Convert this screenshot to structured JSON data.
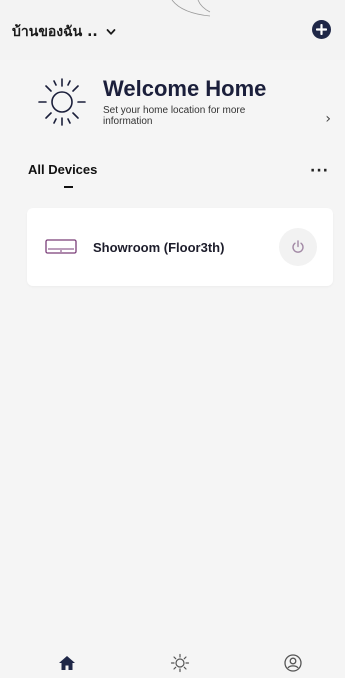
{
  "header": {
    "home_name": "บ้านของฉัน ..",
    "home_dropdown_icon": "chevron-down-icon",
    "add_icon": "plus-circle-icon"
  },
  "welcome": {
    "icon": "sun-icon",
    "title": "Welcome Home",
    "subtitle": "Set your home location for more information",
    "arrow": "›"
  },
  "devices": {
    "section_title": "All Devices",
    "more_label": "···",
    "items": [
      {
        "name": "Showroom (Floor3th)",
        "icon": "air-conditioner-icon",
        "power_icon": "power-icon"
      }
    ]
  },
  "bottom_nav": {
    "items": [
      {
        "icon": "home-icon",
        "active": true
      },
      {
        "icon": "sun-icon",
        "active": false
      },
      {
        "icon": "profile-icon",
        "active": false
      }
    ]
  },
  "colors": {
    "accent": "#1f2747",
    "background": "#f5f5f5",
    "card": "#ffffff",
    "device_icon": "#7a3d78"
  }
}
